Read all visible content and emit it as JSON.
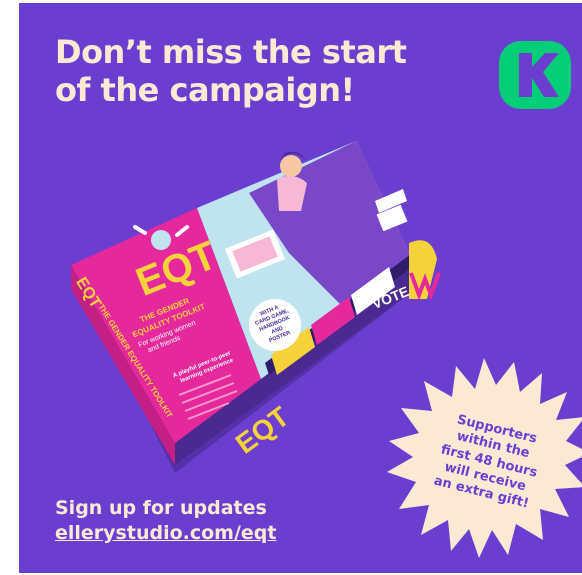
{
  "headline": {
    "line1": "Don’t miss the start",
    "line2": "of the campaign!"
  },
  "logo": {
    "icon": "kickstarter-k-logo",
    "color": "#05ce78"
  },
  "product": {
    "brand": "EQT",
    "title_line1": "THE GENDER",
    "title_line2": "EQUALITY TOOLKIT",
    "subtitle_line1": "For working women",
    "subtitle_line2": "and friends",
    "tagline_line1": "A playful peer-to-peer",
    "tagline_line2": "learning experience",
    "badge_line1": "WITH A",
    "badge_line2": "CARD GAME,",
    "badge_line3": "HANDBOOK",
    "badge_line4": "AND",
    "badge_line5": "POSTER",
    "side_text": "THE GENDER EQUALITY TOOLKIT",
    "poster_word": "VOTE"
  },
  "promo": {
    "line1": "Supporters",
    "line2": "within the",
    "line3": "first 48 hours",
    "line4": "will receive",
    "line5": "an extra gift!"
  },
  "cta": {
    "label": "Sign up for updates",
    "url": "ellerystudio.com/eqt"
  },
  "colors": {
    "background": "#6b3ed0",
    "cream": "#fbe9d4",
    "magenta": "#e5299c",
    "yellow": "#f5d23a",
    "kickstarter_green": "#05ce78"
  }
}
